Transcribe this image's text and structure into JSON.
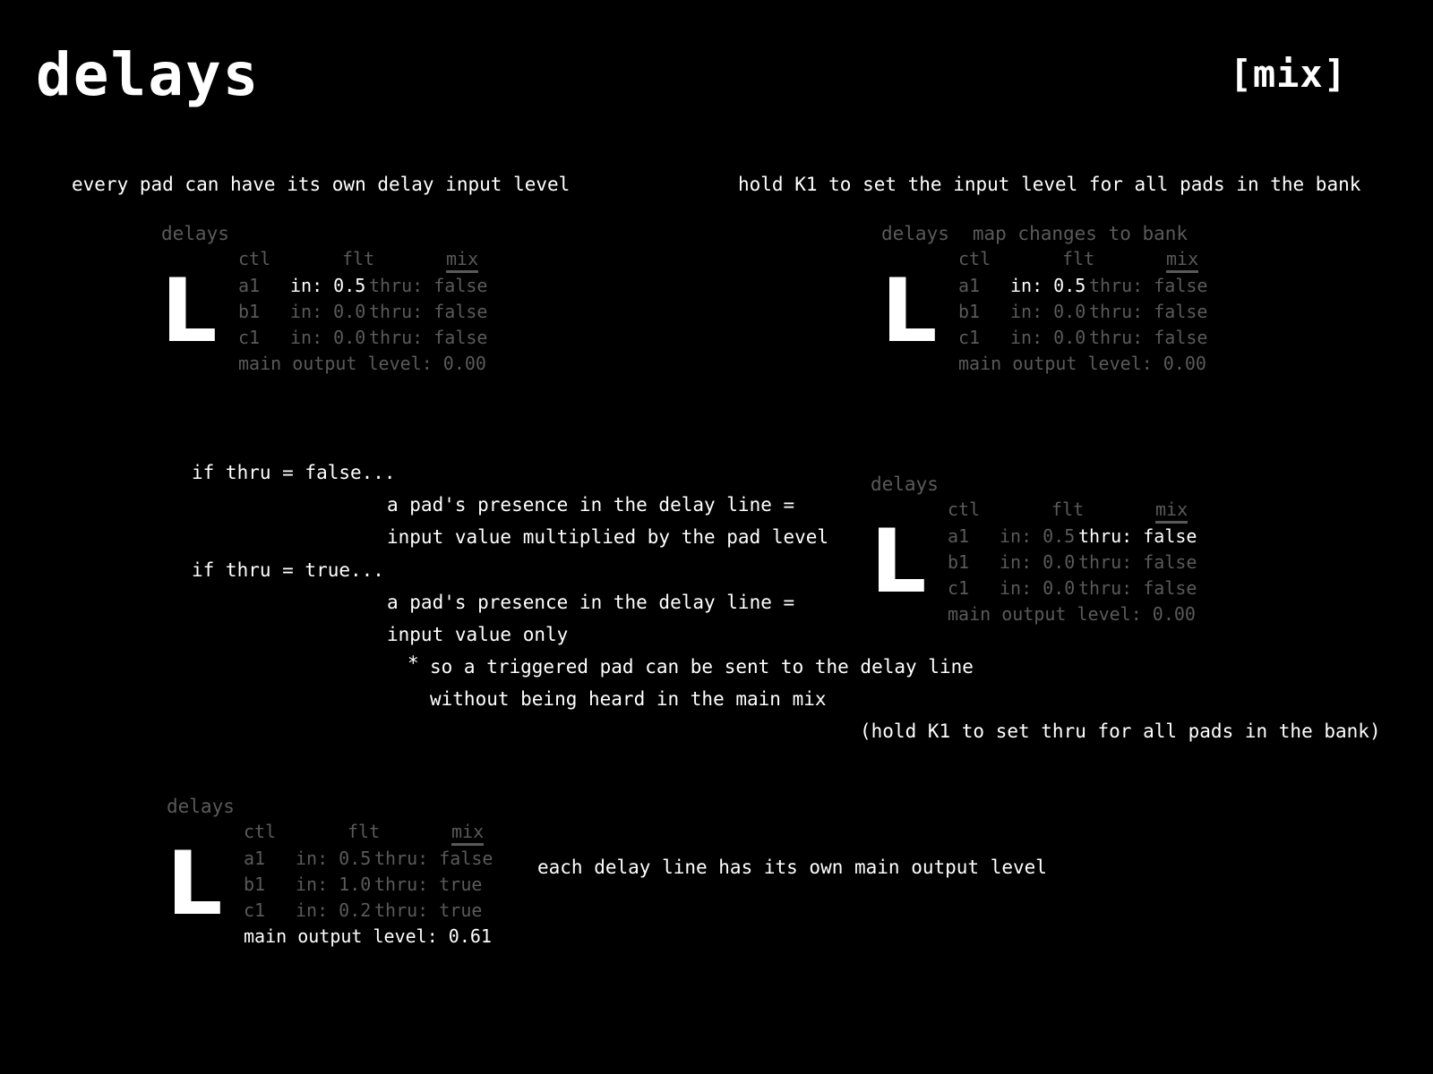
{
  "page": {
    "title": "delays",
    "section": "[mix]"
  },
  "notes": {
    "n1": "every pad can have its own delay input level",
    "n2": "hold K1 to set the input level for all pads in the bank",
    "thru_false": "if thru = false...",
    "thru_false_d1": "a pad's presence in the delay line =",
    "thru_false_d2": "input value multiplied by the pad level",
    "thru_true": "if thru = true...",
    "thru_true_d1": "a pad's presence in the delay line =",
    "thru_true_d2": "input value only",
    "star": "*",
    "so1": "so a triggered pad can be sent to the delay line",
    "so2": "without being heard in the main mix",
    "hold_thru": "(hold K1 to set thru for all pads in the bank)",
    "each_delay": "each delay line has its own main output level"
  },
  "screens": [
    {
      "header": "delays",
      "header_extra": "",
      "channel": "L",
      "tabs": [
        "ctl",
        "flt",
        "mix"
      ],
      "rows": [
        {
          "pad": "a1",
          "in": "in: 0.5",
          "thru": "thru: false"
        },
        {
          "pad": "b1",
          "in": "in: 0.0",
          "thru": "thru: false"
        },
        {
          "pad": "c1",
          "in": "in: 0.0",
          "thru": "thru: false"
        }
      ],
      "main_output": "main output level: 0.00"
    },
    {
      "header": "delays",
      "header_extra": "map changes to bank",
      "channel": "L",
      "tabs": [
        "ctl",
        "flt",
        "mix"
      ],
      "rows": [
        {
          "pad": "a1",
          "in": "in: 0.5",
          "thru": "thru: false"
        },
        {
          "pad": "b1",
          "in": "in: 0.0",
          "thru": "thru: false"
        },
        {
          "pad": "c1",
          "in": "in: 0.0",
          "thru": "thru: false"
        }
      ],
      "main_output": "main output level: 0.00"
    },
    {
      "header": "delays",
      "header_extra": "",
      "channel": "L",
      "tabs": [
        "ctl",
        "flt",
        "mix"
      ],
      "rows": [
        {
          "pad": "a1",
          "in": "in: 0.5",
          "thru": "thru: false"
        },
        {
          "pad": "b1",
          "in": "in: 0.0",
          "thru": "thru: false"
        },
        {
          "pad": "c1",
          "in": "in: 0.0",
          "thru": "thru: false"
        }
      ],
      "main_output": "main output level: 0.00"
    },
    {
      "header": "delays",
      "header_extra": "",
      "channel": "L",
      "tabs": [
        "ctl",
        "flt",
        "mix"
      ],
      "rows": [
        {
          "pad": "a1",
          "in": "in: 0.5",
          "thru": "thru: false"
        },
        {
          "pad": "b1",
          "in": "in: 1.0",
          "thru": "thru: true"
        },
        {
          "pad": "c1",
          "in": "in: 0.2",
          "thru": "thru: true"
        }
      ],
      "main_output": "main output level: 0.61"
    }
  ]
}
